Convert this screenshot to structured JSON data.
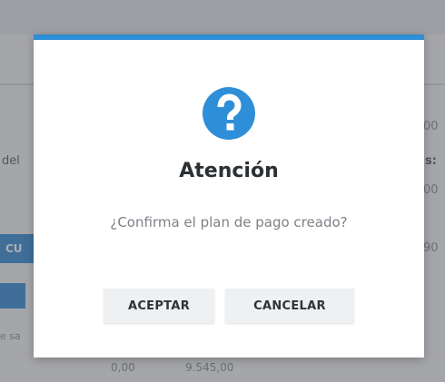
{
  "background": {
    "label_left": "del",
    "label_right": "s:",
    "value_row1": "00",
    "value_row2": "00",
    "value_row3": "90",
    "button_label": "CU",
    "small_text": "e sa",
    "footer_value_1": "0,00",
    "footer_value_2": "9.545,00"
  },
  "dialog": {
    "icon": "question-mark-icon",
    "title": "Atención",
    "message": "¿Confirma el plan de pago creado?",
    "accept_label": "ACEPTAR",
    "cancel_label": "CANCELAR",
    "accent_color": "#2e8fd8"
  }
}
